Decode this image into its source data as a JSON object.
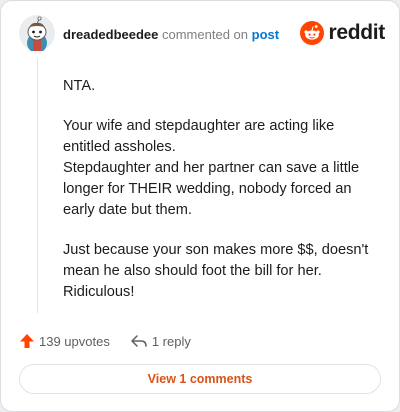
{
  "comment": {
    "author": "dreadedbeedee",
    "action_text": "commented on",
    "target_link": "post",
    "paragraphs": [
      "NTA.",
      "Your wife and stepdaughter are acting like entitled assholes.\nStepdaughter and her partner can save a little longer for THEIR wedding, nobody forced an early date but them.",
      "Just because your son makes more $$, doesn't mean he also should foot the bill for her. Ridiculous!"
    ]
  },
  "brand": {
    "name": "reddit",
    "icon": "reddit-snoo-icon",
    "color": "#ff4500"
  },
  "actions": {
    "upvotes_label": "139 upvotes",
    "reply_label": "1 reply",
    "upvote_icon": "upvote-arrow-icon",
    "reply_icon": "reply-arrow-icon",
    "upvote_color": "#ff4500"
  },
  "view_button": {
    "label": "View 1 comments",
    "color": "#d9541a"
  }
}
